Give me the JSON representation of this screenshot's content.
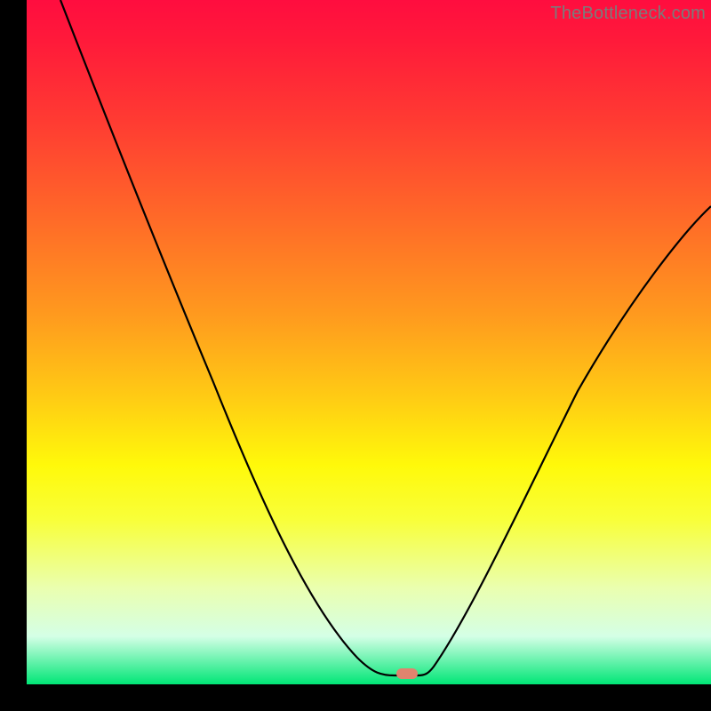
{
  "watermark": "TheBottleneck.com",
  "chart_data": {
    "type": "line",
    "title": "",
    "xlabel": "",
    "ylabel": "",
    "xlim": [
      0,
      100
    ],
    "ylim": [
      0,
      100
    ],
    "series": [
      {
        "name": "bottleneck-curve",
        "x": [
          5,
          10,
          15,
          20,
          25,
          30,
          35,
          40,
          45,
          48,
          50,
          53,
          56,
          57,
          60,
          65,
          70,
          75,
          80,
          85,
          90,
          95,
          100
        ],
        "values": [
          100,
          90,
          81,
          72,
          63,
          54,
          45,
          35,
          23,
          12,
          5,
          1.5,
          1.5,
          2,
          8,
          20,
          32,
          42,
          50,
          57,
          62,
          67,
          70
        ]
      }
    ],
    "marker": {
      "name": "optimum-marker",
      "x": 55.5,
      "y": 2.2,
      "color": "#e0846e"
    },
    "background": {
      "gradient": "vertical",
      "stops": [
        "#ff0d3f",
        "#ffcb14",
        "#fff90a",
        "#00e676"
      ]
    }
  }
}
